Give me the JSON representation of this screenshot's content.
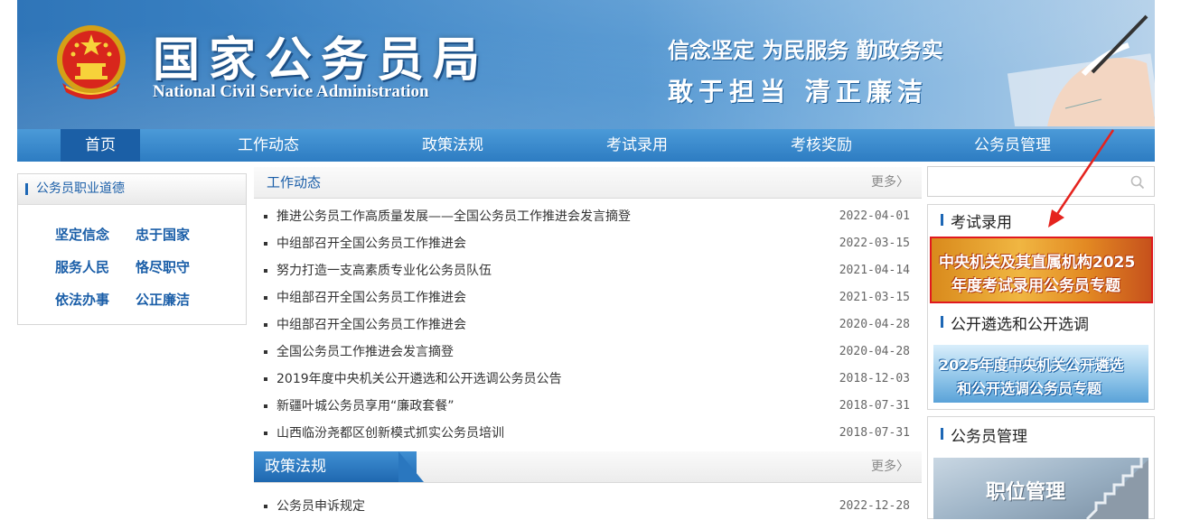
{
  "header": {
    "title_cn": "国家公务员局",
    "title_en": "National Civil Service Administration",
    "slogan_line1": "信念坚定 为民服务 勤政务实",
    "slogan_line2": "敢于担当  清正廉洁"
  },
  "nav": {
    "items": [
      "首页",
      "工作动态",
      "政策法规",
      "考试录用",
      "考核奖励",
      "公务员管理"
    ],
    "active": "首页"
  },
  "ethics": {
    "title": "公务员职业道德",
    "items": [
      "坚定信念",
      "忠于国家",
      "服务人民",
      "恪尽职守",
      "依法办事",
      "公正廉洁"
    ]
  },
  "news": {
    "title": "工作动态",
    "more": "更多〉",
    "items": [
      {
        "title": "推进公务员工作高质量发展——全国公务员工作推进会发言摘登",
        "date": "2022-04-01"
      },
      {
        "title": "中组部召开全国公务员工作推进会",
        "date": "2022-03-15"
      },
      {
        "title": "努力打造一支高素质专业化公务员队伍",
        "date": "2021-04-14"
      },
      {
        "title": "中组部召开全国公务员工作推进会",
        "date": "2021-03-15"
      },
      {
        "title": "中组部召开全国公务员工作推进会",
        "date": "2020-04-28"
      },
      {
        "title": "全国公务员工作推进会发言摘登",
        "date": "2020-04-28"
      },
      {
        "title": "2019年度中央机关公开遴选和公开选调公务员公告",
        "date": "2018-12-03"
      },
      {
        "title": "新疆叶城公务员享用“廉政套餐”",
        "date": "2018-07-31"
      },
      {
        "title": "山西临汾尧都区创新模式抓实公务员培训",
        "date": "2018-07-31"
      }
    ]
  },
  "policy": {
    "title": "政策法规",
    "more": "更多〉",
    "items": [
      {
        "title": "公务员申诉规定",
        "date": "2022-12-28"
      }
    ]
  },
  "sidebar": {
    "search_placeholder": "",
    "exam": {
      "title": "考试录用",
      "banner_line1": "中央机关及其直属机构2025",
      "banner_line2": "年度考试录用公务员专题"
    },
    "selection": {
      "title": "公开遴选和公开选调",
      "banner_line1": "2025年度中央机关公开遴选",
      "banner_line2": "和公开选调公务员专题"
    },
    "management": {
      "title": "公务员管理",
      "banner_line1": "职位管理"
    }
  },
  "colors": {
    "brand_blue": "#1a5ea8",
    "nav_blue": "#2d7cc2",
    "highlight_red": "#e0191f"
  }
}
